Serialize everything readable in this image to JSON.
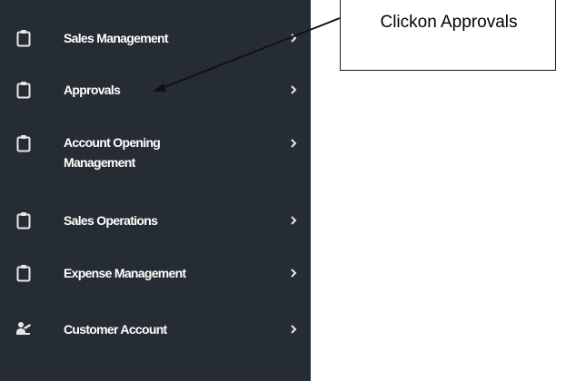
{
  "sidebar": {
    "items": [
      {
        "label": "Sales Management",
        "icon": "clipboard-icon"
      },
      {
        "label": "Approvals",
        "icon": "clipboard-icon"
      },
      {
        "label": "Account Opening Management",
        "icon": "clipboard-icon"
      },
      {
        "label": "Sales Operations",
        "icon": "clipboard-icon"
      },
      {
        "label": "Expense Management",
        "icon": "clipboard-icon"
      },
      {
        "label": "Customer Account",
        "icon": "customer-account-icon"
      }
    ],
    "chevron_icon": "chevron-right-icon"
  },
  "callout": {
    "text": "Clickon Approvals"
  },
  "colors": {
    "sidebar_background": "#262c33",
    "menu_text": "#ffffff",
    "icon": "#e8e8e8"
  }
}
